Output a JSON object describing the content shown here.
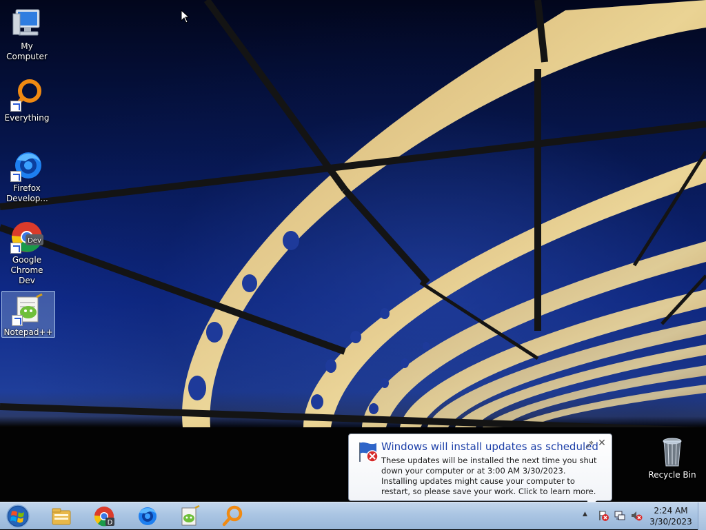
{
  "desktop": {
    "icons": [
      {
        "label": "My Computer",
        "icon": "computer-icon"
      },
      {
        "label": "Everything",
        "icon": "everything-search-icon"
      },
      {
        "label": "Firefox Develop...",
        "icon": "firefox-developer-icon"
      },
      {
        "label": "Google Chrome Dev",
        "icon": "chrome-dev-icon"
      },
      {
        "label": "Notepad++",
        "icon": "notepadpp-icon"
      },
      {
        "label": "Recycle Bin",
        "icon": "recycle-bin-icon"
      }
    ]
  },
  "notification": {
    "title": "Windows will install updates as scheduled",
    "body": "These updates will be installed the next time you shut down your computer or at 3:00 AM 3/30/2023. Installing updates might cause your computer to restart, so please save your work. Click to learn more.",
    "close_symbol": "✕"
  },
  "taskbar": {
    "pinned": [
      "file-explorer-icon",
      "chrome-dev-icon",
      "firefox-developer-icon",
      "notepadpp-icon",
      "everything-search-icon"
    ],
    "tray": {
      "chevron": "▲",
      "icons": [
        "action-center-error-icon",
        "network-icon",
        "volume-muted-icon"
      ]
    },
    "clock": {
      "time": "2:24 AM",
      "date": "3/30/2023"
    }
  },
  "colors": {
    "balloon_title": "#1c3fa8",
    "taskbar_top": "#c3d6ec",
    "taskbar_bottom": "#99b6d8",
    "accent_error": "#d62a2a"
  }
}
